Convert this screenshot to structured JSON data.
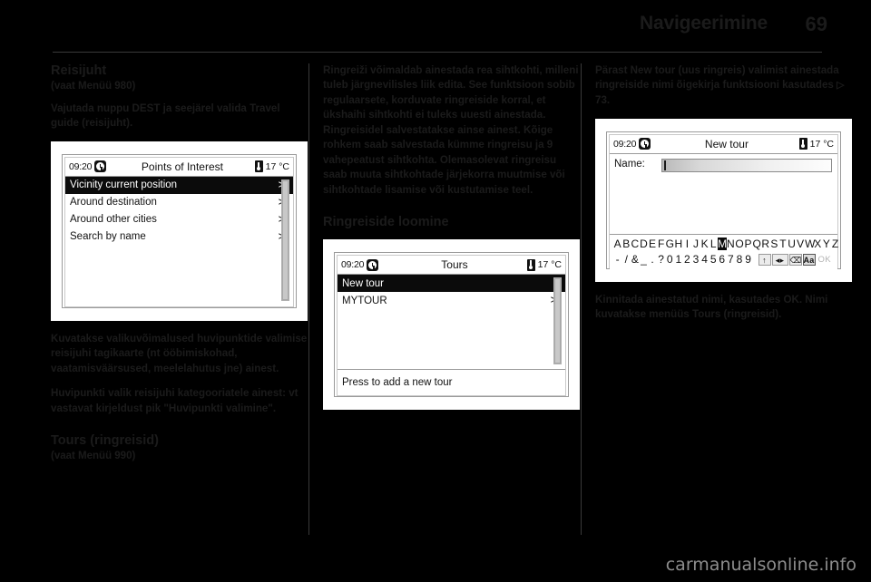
{
  "header": {
    "title": "Navigeerimine",
    "page_number": "69"
  },
  "watermark": "carmanualsonline.info",
  "columns": {
    "left": {
      "heading": "Reisijuht",
      "reference": "(vaat Menüü 980)",
      "paragraph_1": "Vajutada nuppu DEST ja seejärel valida Travel guide (reisijuht).",
      "paragraph_2": "Kuvatakse valikuvõimalused huvipunktide valimise reisijuhi tagikaarte (nt ööbimiskohad, vaatamisväärsused, meelelahutus jne) ainest.",
      "paragraph_3": "Huvipunkti valik reisijuhi kategooriatele ainest: vt vastavat kirjeldust pik \"Huvipunkti valimine\".",
      "heading_2": "Tours (ringreisid)",
      "reference_2": "(vaat Menüü 990)",
      "screen": {
        "time": "09:20",
        "title": "Points of Interest",
        "temperature": "17 °C",
        "clock_icon": "clock-icon",
        "thermometer_icon": "thermometer-icon",
        "items": [
          {
            "label": "Vicinity current position",
            "arrow": "≫",
            "selected": true
          },
          {
            "label": "Around destination",
            "arrow": "≫",
            "selected": false
          },
          {
            "label": "Around other cities",
            "arrow": "≫",
            "selected": false
          },
          {
            "label": "Search by name",
            "arrow": "≫",
            "selected": false
          }
        ]
      }
    },
    "middle": {
      "paragraph_1": "Ringreiži võimaldab ainestada rea sihtkohti, milleni tuleb järgnevilisles liik edita. See funktsioon sobib regulaarsete, korduvate ringreiside korral, et ükshaihi sihtkohti ei tuleks uuesti ainestada. Ringreisidel salvestatakse ainse ainest. Kõige rohkem saab salvestada kümme ringreisu ja 9 vahepeatust sihtkohta. Olemasolevat ringreisu saab muuta sihtkohtade järjekorra muutmise või sihtkohtade lisamise või kustutamise teel.",
      "heading": "Ringreiside loomine",
      "screen": {
        "time": "09:20",
        "title": "Tours",
        "temperature": "17 °C",
        "clock_icon": "clock-icon",
        "thermometer_icon": "thermometer-icon",
        "items": [
          {
            "label": "New tour",
            "arrow": "",
            "selected": true
          },
          {
            "label": "MYTOUR",
            "arrow": "≫",
            "selected": false
          }
        ],
        "footer": "Press to add a new tour"
      }
    },
    "right": {
      "paragraph_1": "Pärast New tour (uus ringreis) valimist ainestada ringreiside nimi õigekirja funktsiooni kasutades",
      "paragraph_1_ref": "73.",
      "ref_arrow": "▷",
      "paragraph_2": "Kinnitada ainestatud nimi, kasutades OK. Nimi kuvatakse menüüs Tours (ringreisid).",
      "screen": {
        "time": "09:20",
        "title": "New tour",
        "temperature": "17 °C",
        "clock_icon": "clock-icon",
        "thermometer_icon": "thermometer-icon",
        "name_label": "Name:",
        "name_value": "",
        "keyboard_row_1": [
          "A",
          "B",
          "C",
          "D",
          "E",
          "F",
          "G",
          "H",
          "I",
          "J",
          "K",
          "L",
          "M",
          "N",
          "O",
          "P",
          "Q",
          "R",
          "S",
          "T",
          "U",
          "V",
          "W",
          "X",
          "Y",
          "Z"
        ],
        "keyboard_row_1_selected": "M",
        "keyboard_row_2": [
          "-",
          "/",
          "&",
          "_",
          ".",
          "?",
          "0",
          "1",
          "2",
          "3",
          "4",
          "5",
          "6",
          "7",
          "8",
          "9"
        ],
        "keyboard_icons": [
          {
            "name": "shift-icon",
            "glyph": "↑"
          },
          {
            "name": "cursor-move-icon",
            "glyph": "◂▸"
          },
          {
            "name": "backspace-icon",
            "glyph": "⌫"
          },
          {
            "name": "case-toggle-icon",
            "glyph": "Aa"
          }
        ],
        "ok_label": "OK"
      }
    }
  }
}
